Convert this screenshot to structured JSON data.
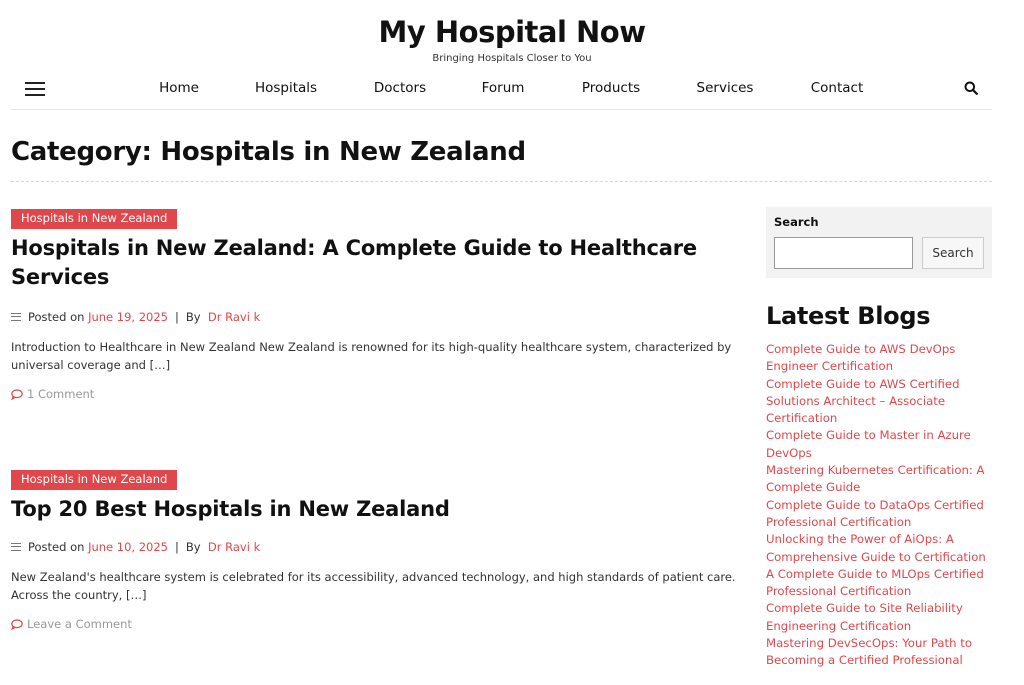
{
  "site": {
    "title": "My Hospital Now",
    "tagline": "Bringing Hospitals Closer to You"
  },
  "nav": {
    "items": [
      "Home",
      "Hospitals",
      "Doctors",
      "Forum",
      "Products",
      "Services",
      "Contact"
    ]
  },
  "page": {
    "title": "Category: Hospitals in New Zealand"
  },
  "posts": [
    {
      "category": "Hospitals in New Zealand",
      "title": "Hospitals in New Zealand: A Complete Guide to Healthcare Services",
      "posted_on_label": "Posted on",
      "date": "June 19, 2025",
      "separator": "|",
      "by_label": "By",
      "author": "Dr Ravi k",
      "excerpt": "Introduction to Healthcare in New Zealand New Zealand is renowned for its high-quality healthcare system, characterized by universal coverage and […]",
      "comments": "1 Comment"
    },
    {
      "category": "Hospitals in New Zealand",
      "title": "Top 20 Best Hospitals in New Zealand",
      "posted_on_label": "Posted on",
      "date": "June 10, 2025",
      "separator": "|",
      "by_label": "By",
      "author": "Dr Ravi k",
      "excerpt": "New Zealand's healthcare system is celebrated for its accessibility, advanced technology, and high standards of patient care. Across the country, […]",
      "comments": "Leave a Comment"
    }
  ],
  "sidebar": {
    "search": {
      "label": "Search",
      "placeholder": "",
      "button_label": "Search"
    },
    "latest": {
      "title": "Latest Blogs",
      "items": [
        "Complete Guide to AWS DevOps Engineer Certification",
        "Complete Guide to AWS Certified Solutions Architect – Associate Certification",
        "Complete Guide to Master in Azure DevOps",
        "Mastering Kubernetes Certification: A Complete Guide",
        "Complete Guide to DataOps Certified Professional Certification",
        "Unlocking the Power of AiOps: A Comprehensive Guide to Certification",
        "A Complete Guide to MLOps Certified Professional Certification",
        "Complete Guide to Site Reliability Engineering Certification",
        "Mastering DevSecOps: Your Path to Becoming a Certified Professional"
      ]
    }
  },
  "colors": {
    "accent": "#e0474c",
    "text": "#111111",
    "muted": "#999999",
    "sidebar_bg": "#f2f2f2"
  },
  "icons": {
    "menu": "hamburger-icon",
    "search": "search-icon",
    "meta": "list-icon",
    "comment": "comment-icon"
  }
}
